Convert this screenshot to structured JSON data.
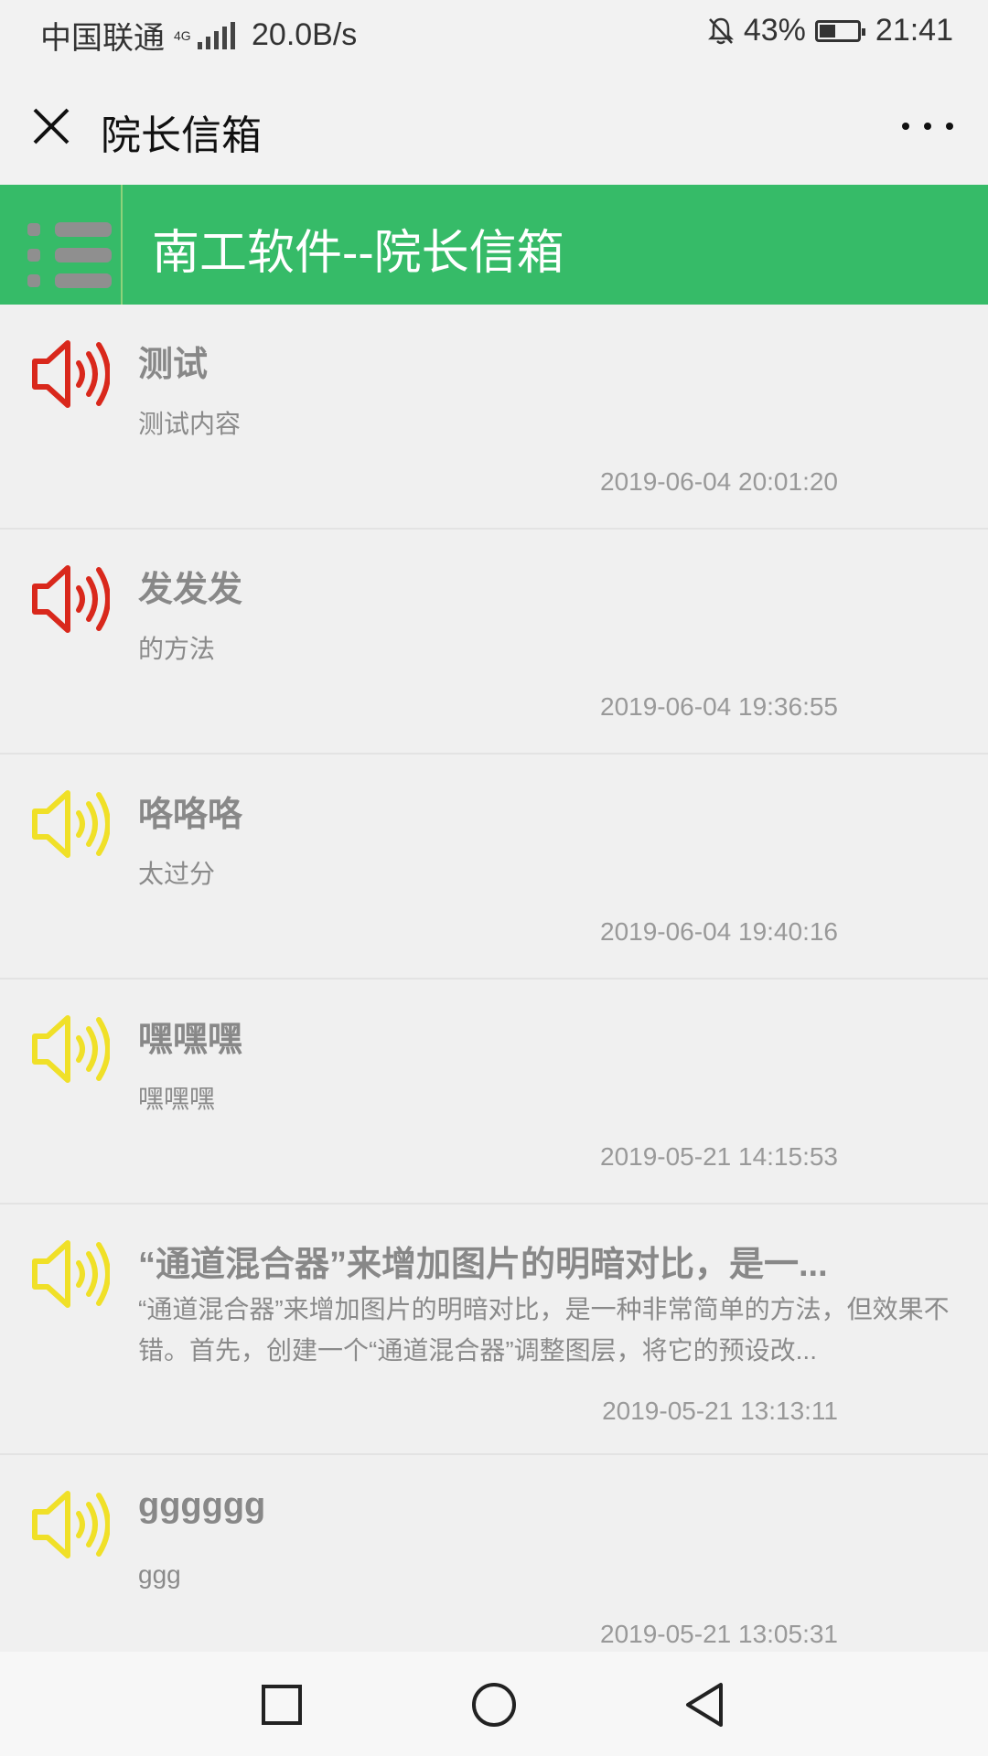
{
  "status_bar": {
    "carrier": "中国联通",
    "network": "4G",
    "speed": "20.0B/s",
    "battery": "43%",
    "battery_level": 0.43,
    "time": "21:41",
    "icons": [
      "signal-icon",
      "bell-off-icon",
      "battery-icon"
    ]
  },
  "title_bar": {
    "title": "院长信箱",
    "icons": [
      "close-icon",
      "more-icon"
    ]
  },
  "header": {
    "title": "南工软件--院长信箱",
    "icon": "menu-icon",
    "accent_color": "#36bb68"
  },
  "messages": [
    {
      "title": "测试",
      "content": "测试内容",
      "date": "2019-06-04 20:01:20",
      "icon": "speaker-icon",
      "icon_color": "#d9281c"
    },
    {
      "title": "发发发",
      "content": "的方法",
      "date": "2019-06-04 19:36:55",
      "icon": "speaker-icon",
      "icon_color": "#d9281c"
    },
    {
      "title": "咯咯咯",
      "content": "太过分",
      "date": "2019-06-04 19:40:16",
      "icon": "speaker-icon",
      "icon_color": "#f0e028"
    },
    {
      "title": "嘿嘿嘿",
      "content": "嘿嘿嘿",
      "date": "2019-05-21 14:15:53",
      "icon": "speaker-icon",
      "icon_color": "#f0e028"
    },
    {
      "title": "“通道混合器”来增加图片的明暗对比，是一...",
      "content": "“通道混合器”来增加图片的明暗对比，是一种非常简单的方法，但效果不错。首先，创建一个“通道混合器”调整图层，将它的预设改...",
      "date": "2019-05-21 13:13:11",
      "icon": "speaker-icon",
      "icon_color": "#f0e028"
    },
    {
      "title": "gggggg",
      "content": "ggg",
      "date": "2019-05-21 13:05:31",
      "icon": "speaker-icon",
      "icon_color": "#f0e028"
    }
  ],
  "nav_bar": {
    "icons": [
      "square-icon",
      "circle-icon",
      "back-triangle-icon"
    ]
  }
}
